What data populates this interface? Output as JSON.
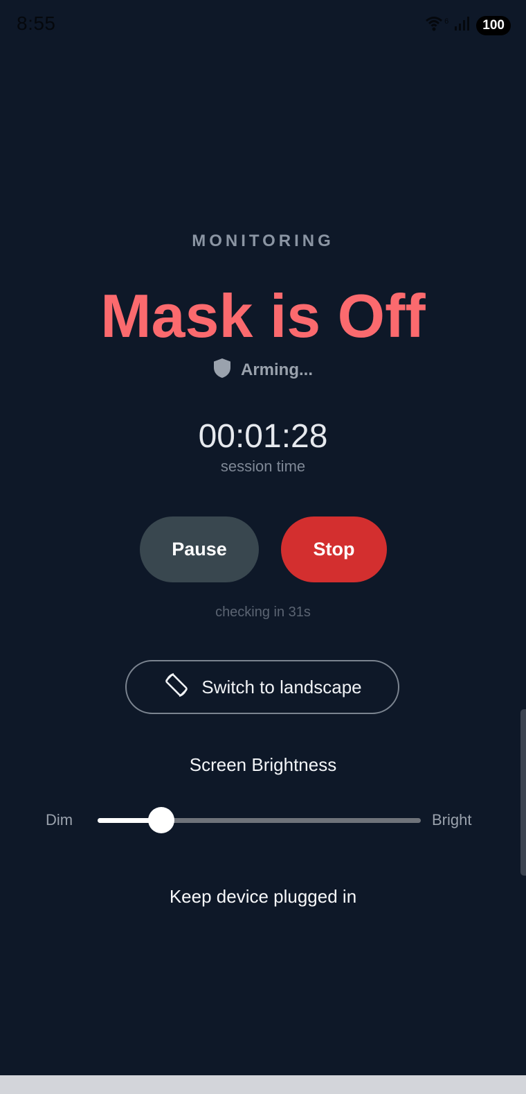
{
  "status_bar": {
    "time": "8:55",
    "battery": "100",
    "wifi_badge": "6"
  },
  "monitor": {
    "section_label": "MONITORING",
    "state": "Mask is Off",
    "arming_status": "Arming...",
    "session_time": "00:01:28",
    "session_label": "session time",
    "checking_text": "checking in 31s"
  },
  "controls": {
    "pause_label": "Pause",
    "stop_label": "Stop",
    "landscape_label": "Switch to landscape"
  },
  "brightness": {
    "title": "Screen Brightness",
    "min_label": "Dim",
    "max_label": "Bright",
    "level": 0.197
  },
  "footer": {
    "note": "Keep device plugged in"
  },
  "colors": {
    "background": "#0e1828",
    "alert": "#fb6a6e",
    "stop": "#d32f2f",
    "pause": "#39474f"
  },
  "icons": {
    "arming": "shield-icon",
    "landscape": "screen-rotation-icon",
    "wifi": "wifi-icon",
    "signal": "signal-icon"
  }
}
